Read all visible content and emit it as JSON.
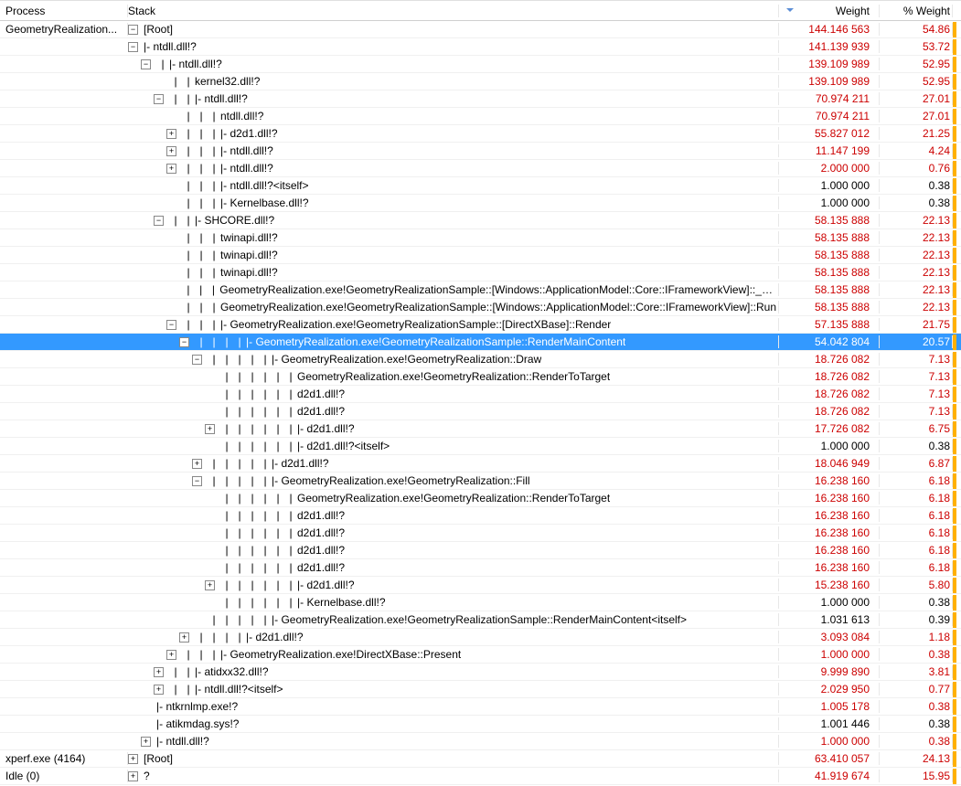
{
  "columns": {
    "process": "Process",
    "stack": "Stack",
    "weight": "Weight",
    "pct": "% Weight"
  },
  "rows": [
    {
      "process": "GeometryRealization...",
      "depth": 0,
      "exp": "-",
      "pipes": 0,
      "prefix": "",
      "label": "[Root]",
      "weight": "144.146 563",
      "pct": "54.86",
      "color": "red",
      "sel": false
    },
    {
      "process": "",
      "depth": 0,
      "exp": "-",
      "pipes": 0,
      "prefix": "|- ",
      "label": "ntdll.dll!?",
      "weight": "141.139 939",
      "pct": "53.72",
      "color": "red",
      "sel": false
    },
    {
      "process": "",
      "depth": 1,
      "exp": "-",
      "pipes": 1,
      "prefix": "|- ",
      "label": "ntdll.dll!?",
      "weight": "139.109 989",
      "pct": "52.95",
      "color": "red",
      "sel": false
    },
    {
      "process": "",
      "depth": 2,
      "exp": "",
      "pipes": 2,
      "prefix": "",
      "label": "kernel32.dll!?",
      "weight": "139.109 989",
      "pct": "52.95",
      "color": "red",
      "sel": false
    },
    {
      "process": "",
      "depth": 2,
      "exp": "-",
      "pipes": 2,
      "prefix": "|- ",
      "label": "ntdll.dll!?",
      "weight": "70.974 211",
      "pct": "27.01",
      "color": "red",
      "sel": false
    },
    {
      "process": "",
      "depth": 3,
      "exp": "",
      "pipes": 3,
      "prefix": "",
      "label": "ntdll.dll!?",
      "weight": "70.974 211",
      "pct": "27.01",
      "color": "red",
      "sel": false
    },
    {
      "process": "",
      "depth": 3,
      "exp": "+",
      "pipes": 3,
      "prefix": "|- ",
      "label": "d2d1.dll!?",
      "weight": "55.827 012",
      "pct": "21.25",
      "color": "red",
      "sel": false
    },
    {
      "process": "",
      "depth": 3,
      "exp": "+",
      "pipes": 3,
      "prefix": "|- ",
      "label": "ntdll.dll!?",
      "weight": "11.147 199",
      "pct": "4.24",
      "color": "red",
      "sel": false
    },
    {
      "process": "",
      "depth": 3,
      "exp": "+",
      "pipes": 3,
      "prefix": "|- ",
      "label": "ntdll.dll!?",
      "weight": "2.000 000",
      "pct": "0.76",
      "color": "red",
      "sel": false
    },
    {
      "process": "",
      "depth": 3,
      "exp": "",
      "pipes": 3,
      "prefix": "|- ",
      "label": "ntdll.dll!?<itself>",
      "weight": "1.000 000",
      "pct": "0.38",
      "color": "blk",
      "sel": false
    },
    {
      "process": "",
      "depth": 3,
      "exp": "",
      "pipes": 3,
      "prefix": "|- ",
      "label": "Kernelbase.dll!?",
      "weight": "1.000 000",
      "pct": "0.38",
      "color": "blk",
      "sel": false
    },
    {
      "process": "",
      "depth": 2,
      "exp": "-",
      "pipes": 2,
      "prefix": "|- ",
      "label": "SHCORE.dll!?",
      "weight": "58.135 888",
      "pct": "22.13",
      "color": "red",
      "sel": false
    },
    {
      "process": "",
      "depth": 3,
      "exp": "",
      "pipes": 3,
      "prefix": "",
      "label": "twinapi.dll!?",
      "weight": "58.135 888",
      "pct": "22.13",
      "color": "red",
      "sel": false
    },
    {
      "process": "",
      "depth": 3,
      "exp": "",
      "pipes": 3,
      "prefix": "",
      "label": "twinapi.dll!?",
      "weight": "58.135 888",
      "pct": "22.13",
      "color": "red",
      "sel": false
    },
    {
      "process": "",
      "depth": 3,
      "exp": "",
      "pipes": 3,
      "prefix": "",
      "label": "twinapi.dll!?",
      "weight": "58.135 888",
      "pct": "22.13",
      "color": "red",
      "sel": false
    },
    {
      "process": "",
      "depth": 3,
      "exp": "",
      "pipes": 3,
      "prefix": "",
      "label": "GeometryRealization.exe!GeometryRealizationSample::[Windows::ApplicationModel::Core::IFrameworkView]::__abi_",
      "weight": "58.135 888",
      "pct": "22.13",
      "color": "red",
      "sel": false
    },
    {
      "process": "",
      "depth": 3,
      "exp": "",
      "pipes": 3,
      "prefix": "",
      "label": "GeometryRealization.exe!GeometryRealizationSample::[Windows::ApplicationModel::Core::IFrameworkView]::Run",
      "weight": "58.135 888",
      "pct": "22.13",
      "color": "red",
      "sel": false
    },
    {
      "process": "",
      "depth": 3,
      "exp": "-",
      "pipes": 3,
      "prefix": "|- ",
      "label": "GeometryRealization.exe!GeometryRealizationSample::[DirectXBase]::Render",
      "weight": "57.135 888",
      "pct": "21.75",
      "color": "red",
      "sel": false
    },
    {
      "process": "",
      "depth": 4,
      "exp": "-",
      "pipes": 4,
      "prefix": "|- ",
      "label": "GeometryRealization.exe!GeometryRealizationSample::RenderMainContent",
      "weight": "54.042 804",
      "pct": "20.57",
      "color": "red",
      "sel": true
    },
    {
      "process": "",
      "depth": 5,
      "exp": "-",
      "pipes": 5,
      "prefix": "|- ",
      "label": "GeometryRealization.exe!GeometryRealization::Draw",
      "weight": "18.726 082",
      "pct": "7.13",
      "color": "red",
      "sel": false
    },
    {
      "process": "",
      "depth": 6,
      "exp": "",
      "pipes": 6,
      "prefix": "",
      "label": "GeometryRealization.exe!GeometryRealization::RenderToTarget",
      "weight": "18.726 082",
      "pct": "7.13",
      "color": "red",
      "sel": false
    },
    {
      "process": "",
      "depth": 6,
      "exp": "",
      "pipes": 6,
      "prefix": "",
      "label": "d2d1.dll!?",
      "weight": "18.726 082",
      "pct": "7.13",
      "color": "red",
      "sel": false
    },
    {
      "process": "",
      "depth": 6,
      "exp": "",
      "pipes": 6,
      "prefix": "",
      "label": "d2d1.dll!?",
      "weight": "18.726 082",
      "pct": "7.13",
      "color": "red",
      "sel": false
    },
    {
      "process": "",
      "depth": 6,
      "exp": "+",
      "pipes": 6,
      "prefix": "|- ",
      "label": "d2d1.dll!?",
      "weight": "17.726 082",
      "pct": "6.75",
      "color": "red",
      "sel": false
    },
    {
      "process": "",
      "depth": 6,
      "exp": "",
      "pipes": 6,
      "prefix": "|- ",
      "label": "d2d1.dll!?<itself>",
      "weight": "1.000 000",
      "pct": "0.38",
      "color": "blk",
      "sel": false
    },
    {
      "process": "",
      "depth": 5,
      "exp": "+",
      "pipes": 5,
      "prefix": "|- ",
      "label": "d2d1.dll!?",
      "weight": "18.046 949",
      "pct": "6.87",
      "color": "red",
      "sel": false
    },
    {
      "process": "",
      "depth": 5,
      "exp": "-",
      "pipes": 5,
      "prefix": "|- ",
      "label": "GeometryRealization.exe!GeometryRealization::Fill",
      "weight": "16.238 160",
      "pct": "6.18",
      "color": "red",
      "sel": false
    },
    {
      "process": "",
      "depth": 6,
      "exp": "",
      "pipes": 6,
      "prefix": "",
      "label": "GeometryRealization.exe!GeometryRealization::RenderToTarget",
      "weight": "16.238 160",
      "pct": "6.18",
      "color": "red",
      "sel": false
    },
    {
      "process": "",
      "depth": 6,
      "exp": "",
      "pipes": 6,
      "prefix": "",
      "label": "d2d1.dll!?",
      "weight": "16.238 160",
      "pct": "6.18",
      "color": "red",
      "sel": false
    },
    {
      "process": "",
      "depth": 6,
      "exp": "",
      "pipes": 6,
      "prefix": "",
      "label": "d2d1.dll!?",
      "weight": "16.238 160",
      "pct": "6.18",
      "color": "red",
      "sel": false
    },
    {
      "process": "",
      "depth": 6,
      "exp": "",
      "pipes": 6,
      "prefix": "",
      "label": "d2d1.dll!?",
      "weight": "16.238 160",
      "pct": "6.18",
      "color": "red",
      "sel": false
    },
    {
      "process": "",
      "depth": 6,
      "exp": "",
      "pipes": 6,
      "prefix": "",
      "label": "d2d1.dll!?",
      "weight": "16.238 160",
      "pct": "6.18",
      "color": "red",
      "sel": false
    },
    {
      "process": "",
      "depth": 6,
      "exp": "+",
      "pipes": 6,
      "prefix": "|- ",
      "label": "d2d1.dll!?",
      "weight": "15.238 160",
      "pct": "5.80",
      "color": "red",
      "sel": false
    },
    {
      "process": "",
      "depth": 6,
      "exp": "",
      "pipes": 6,
      "prefix": "|- ",
      "label": "Kernelbase.dll!?",
      "weight": "1.000 000",
      "pct": "0.38",
      "color": "blk",
      "sel": false
    },
    {
      "process": "",
      "depth": 5,
      "exp": "",
      "pipes": 5,
      "prefix": "|- ",
      "label": "GeometryRealization.exe!GeometryRealizationSample::RenderMainContent<itself>",
      "weight": "1.031 613",
      "pct": "0.39",
      "color": "blk",
      "sel": false
    },
    {
      "process": "",
      "depth": 4,
      "exp": "+",
      "pipes": 4,
      "prefix": "|- ",
      "label": "d2d1.dll!?",
      "weight": "3.093 084",
      "pct": "1.18",
      "color": "red",
      "sel": false
    },
    {
      "process": "",
      "depth": 3,
      "exp": "+",
      "pipes": 3,
      "prefix": "|- ",
      "label": "GeometryRealization.exe!DirectXBase::Present",
      "weight": "1.000 000",
      "pct": "0.38",
      "color": "red",
      "sel": false
    },
    {
      "process": "",
      "depth": 2,
      "exp": "+",
      "pipes": 2,
      "prefix": "|- ",
      "label": "atidxx32.dll!?",
      "weight": "9.999 890",
      "pct": "3.81",
      "color": "red",
      "sel": false
    },
    {
      "process": "",
      "depth": 2,
      "exp": "+",
      "pipes": 2,
      "prefix": "|- ",
      "label": "ntdll.dll!?<itself>",
      "weight": "2.029 950",
      "pct": "0.77",
      "color": "red",
      "sel": false
    },
    {
      "process": "",
      "depth": 1,
      "exp": "",
      "pipes": 0,
      "prefix": "|- ",
      "label": "ntkrnlmp.exe!?",
      "weight": "1.005 178",
      "pct": "0.38",
      "color": "red",
      "sel": false
    },
    {
      "process": "",
      "depth": 1,
      "exp": "",
      "pipes": 0,
      "prefix": "|- ",
      "label": "atikmdag.sys!?",
      "weight": "1.001 446",
      "pct": "0.38",
      "color": "blk",
      "sel": false
    },
    {
      "process": "",
      "depth": 1,
      "exp": "+",
      "pipes": 0,
      "prefix": "|- ",
      "label": "ntdll.dll!?",
      "weight": "1.000 000",
      "pct": "0.38",
      "color": "red",
      "sel": false
    },
    {
      "process": "xperf.exe (4164)",
      "depth": 0,
      "exp": "+",
      "pipes": 0,
      "prefix": "",
      "label": "[Root]",
      "weight": "63.410 057",
      "pct": "24.13",
      "color": "red",
      "sel": false
    },
    {
      "process": "Idle (0)",
      "depth": 0,
      "exp": "+",
      "pipes": 0,
      "prefix": "",
      "label": "?",
      "weight": "41.919 674",
      "pct": "15.95",
      "color": "red",
      "sel": false
    }
  ]
}
